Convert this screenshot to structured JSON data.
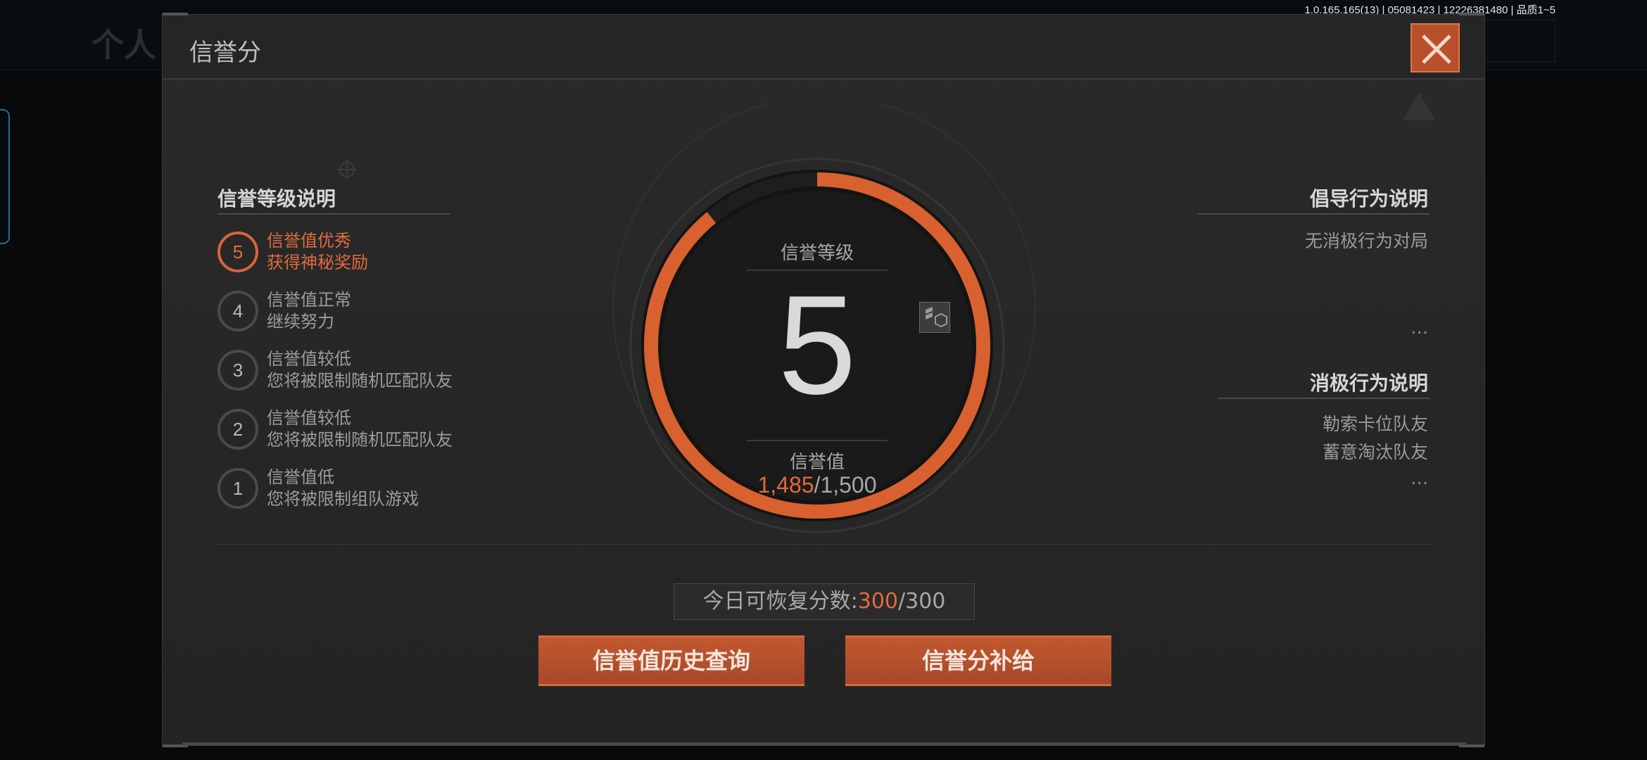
{
  "version_text": "1.0.165.165(13) | 05081423 | 12226381480 | 品质1~5",
  "background": {
    "page_title": "个人"
  },
  "modal": {
    "title": "信誉分",
    "left_panel": {
      "title": "信誉等级说明",
      "levels": [
        {
          "level": "5",
          "line1": "信誉值优秀",
          "line2": "获得神秘奖励",
          "active": true
        },
        {
          "level": "4",
          "line1": "信誉值正常",
          "line2": "继续努力",
          "active": false
        },
        {
          "level": "3",
          "line1": "信誉值较低",
          "line2": "您将被限制随机匹配队友",
          "active": false
        },
        {
          "level": "2",
          "line1": "信誉值较低",
          "line2": "您将被限制随机匹配队友",
          "active": false
        },
        {
          "level": "1",
          "line1": "信誉值低",
          "line2": "您将被限制组队游戏",
          "active": false
        }
      ]
    },
    "center": {
      "level_label": "信誉等级",
      "level_value": "5",
      "score_label": "信誉值",
      "score_current": "1,485",
      "score_max": "/1,500",
      "score_fraction": 0.99
    },
    "right_panel": {
      "encouraged_title": "倡导行为说明",
      "encouraged_items": [
        "无消极行为对局"
      ],
      "encouraged_more": "...",
      "negative_title": "消极行为说明",
      "negative_items": [
        "勒索卡位队友",
        "蓄意淘汰队友"
      ],
      "negative_more": "..."
    },
    "recover": {
      "label": "今日可恢复分数:",
      "current": "300",
      "max": "/300"
    },
    "buttons": {
      "history": "信誉值历史查询",
      "supply": "信誉分补给"
    }
  },
  "colors": {
    "accent": "#e06b3e",
    "button": "#b8502c",
    "panel": "#2a2a2a"
  },
  "icons": [
    "close-icon",
    "crosshair-icon",
    "warning-icon",
    "badge-icon"
  ]
}
